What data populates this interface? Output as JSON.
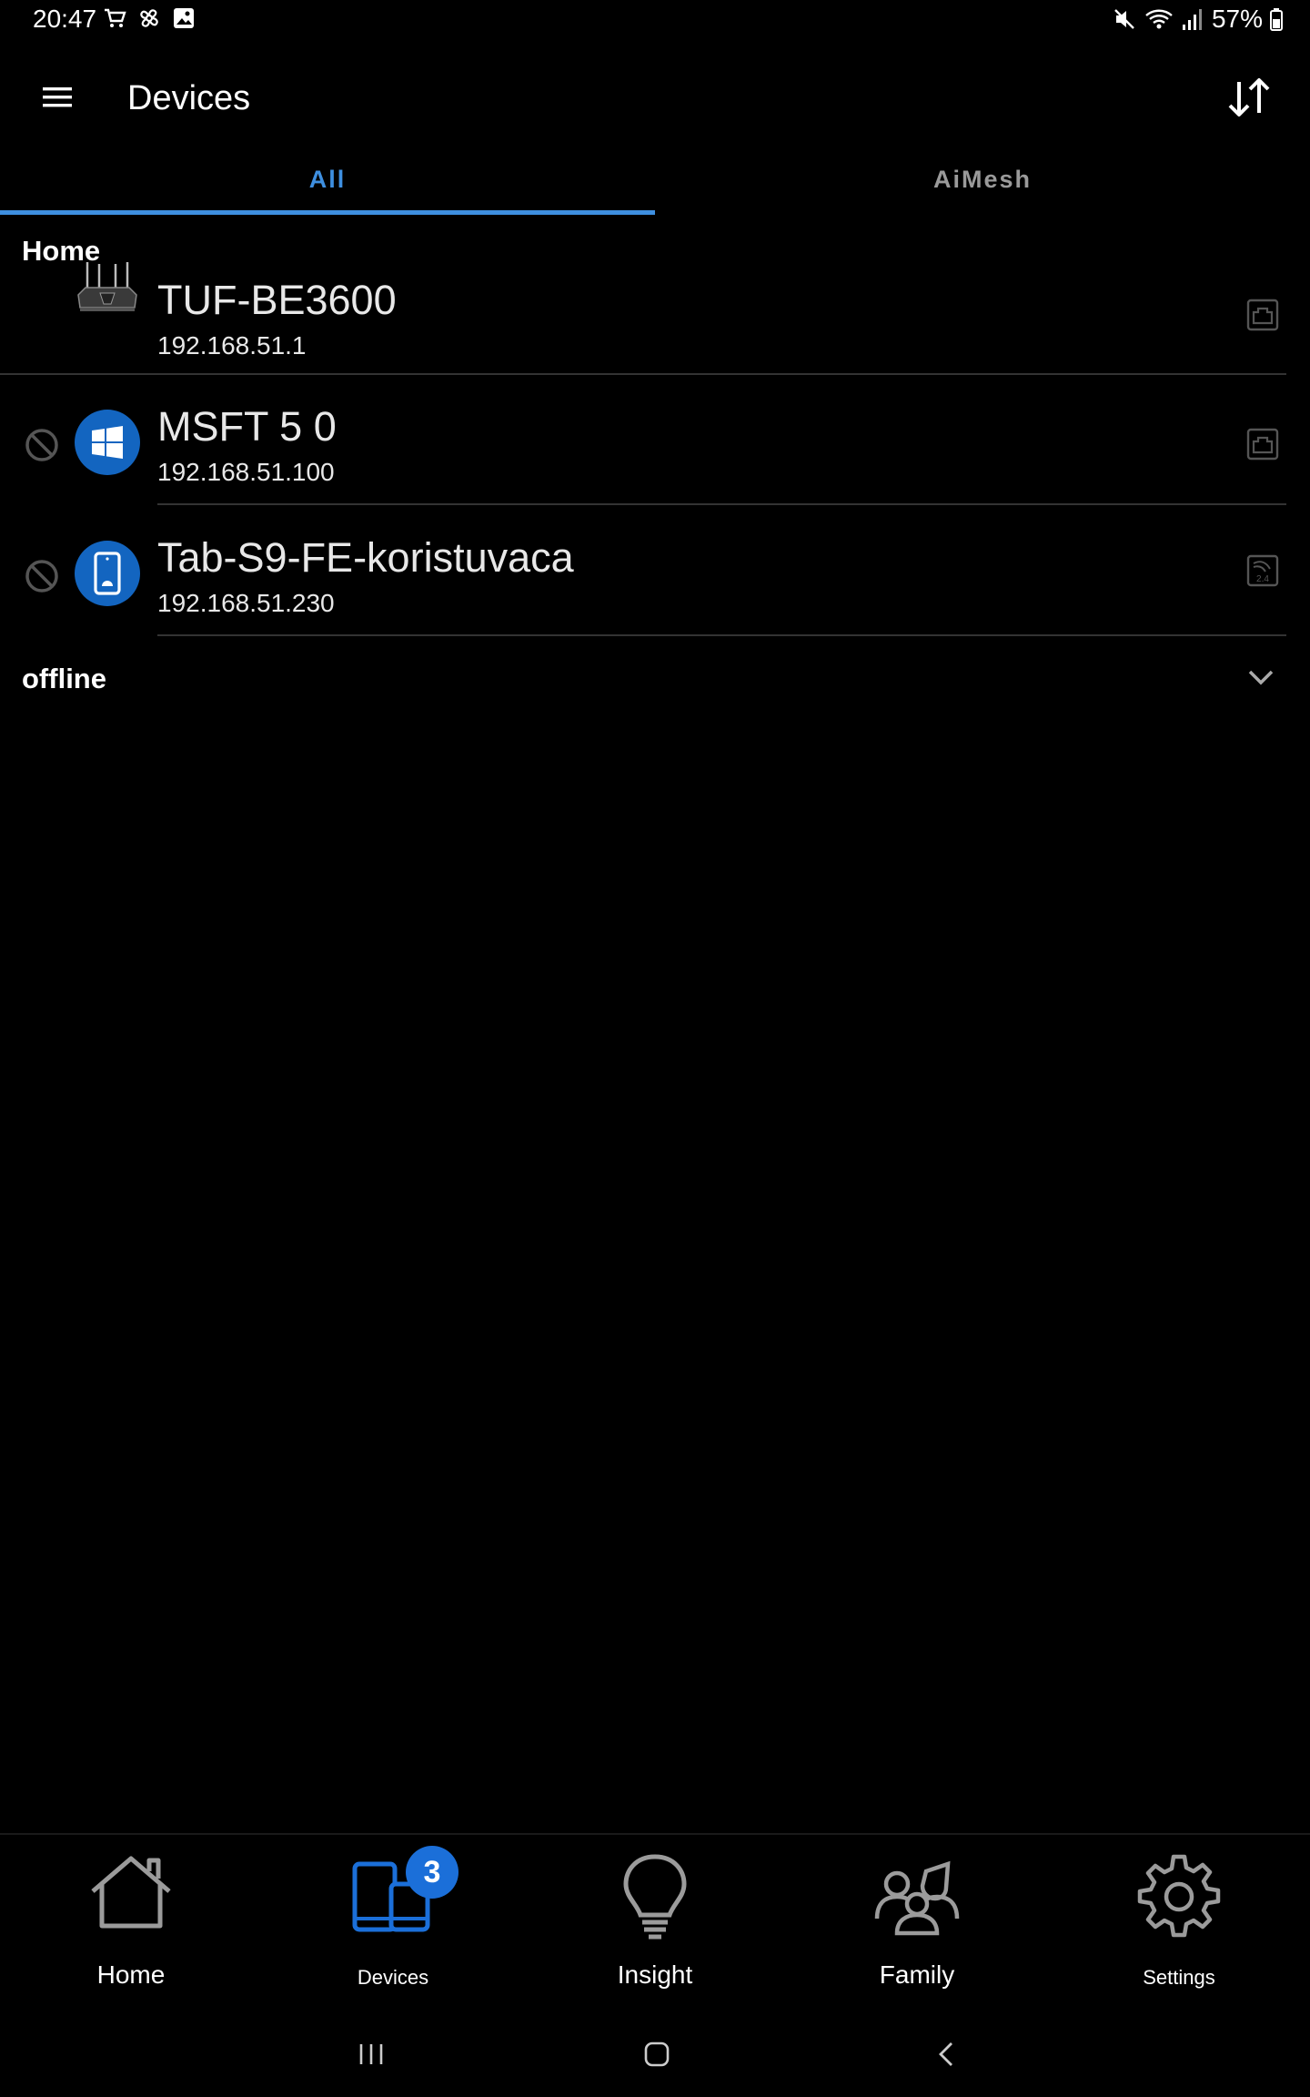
{
  "status_bar": {
    "time": "20:47",
    "battery": "57%"
  },
  "app_bar": {
    "title": "Devices"
  },
  "tabs": [
    {
      "label": "All",
      "active": true
    },
    {
      "label": "AiMesh",
      "active": false
    }
  ],
  "sections": {
    "home": {
      "title": "Home",
      "devices": [
        {
          "name": "TUF-BE3600",
          "ip": "192.168.51.1",
          "icon": "router-icon",
          "connection": "ethernet-icon"
        },
        {
          "name": "MSFT 5 0",
          "ip": "192.168.51.100",
          "icon": "windows-icon",
          "connection": "ethernet-icon"
        },
        {
          "name": "Tab-S9-FE-koristuvaca",
          "ip": "192.168.51.230",
          "icon": "tablet-icon",
          "connection": "wifi-2.4-icon"
        }
      ]
    },
    "offline": {
      "title": "offline"
    }
  },
  "wifi_band_label": "2.4",
  "bottom_nav": {
    "items": [
      {
        "label": "Home",
        "icon": "house-icon"
      },
      {
        "label": "Devices",
        "icon": "devices-icon",
        "badge": "3"
      },
      {
        "label": "Insight",
        "icon": "lightbulb-icon"
      },
      {
        "label": "Family",
        "icon": "family-icon"
      },
      {
        "label": "Settings",
        "icon": "gear-icon"
      }
    ]
  },
  "colors": {
    "accent": "#3e8fe0",
    "avatar_blue": "#1365c0",
    "badge_blue": "#1b6fd9",
    "background": "#000000"
  }
}
